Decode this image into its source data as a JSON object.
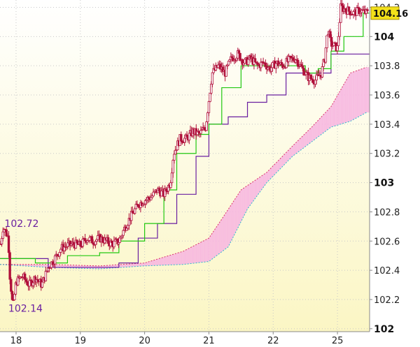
{
  "chart_data": {
    "type": "candlestick",
    "y_ticks": [
      {
        "value": 102,
        "label": "102",
        "major": true
      },
      {
        "value": 102.2,
        "label": "102.2",
        "major": false
      },
      {
        "value": 102.4,
        "label": "102.4",
        "major": false
      },
      {
        "value": 102.6,
        "label": "102.6",
        "major": false
      },
      {
        "value": 102.8,
        "label": "102.8",
        "major": false
      },
      {
        "value": 103,
        "label": "103",
        "major": true
      },
      {
        "value": 103.2,
        "label": "103.2",
        "major": false
      },
      {
        "value": 103.4,
        "label": "103.4",
        "major": false
      },
      {
        "value": 103.6,
        "label": "103.6",
        "major": false
      },
      {
        "value": 103.8,
        "label": "103.8",
        "major": false
      },
      {
        "value": 104,
        "label": "104",
        "major": true
      },
      {
        "value": 104.2,
        "label": "104.2",
        "major": false
      }
    ],
    "x_ticks": [
      {
        "value": 0,
        "label": "18"
      },
      {
        "value": 1,
        "label": "19"
      },
      {
        "value": 2,
        "label": "20"
      },
      {
        "value": 3,
        "label": "21"
      },
      {
        "value": 4,
        "label": "22"
      },
      {
        "value": 5,
        "label": "25"
      }
    ],
    "xlim": [
      -0.25,
      5.5
    ],
    "ylim": [
      101.98,
      104.25
    ],
    "current_price": {
      "value": 104.16,
      "label": "104.16"
    },
    "annotations": [
      {
        "label": "102.72",
        "x": -0.18,
        "y": 102.72
      },
      {
        "label": "102.14",
        "x": -0.12,
        "y": 102.14
      }
    ],
    "ohlc_path": [
      [
        -0.25,
        102.55
      ],
      [
        -0.2,
        102.7
      ],
      [
        -0.12,
        102.62
      ],
      [
        -0.1,
        102.38
      ],
      [
        -0.05,
        102.14
      ],
      [
        0.0,
        102.32
      ],
      [
        0.1,
        102.36
      ],
      [
        0.2,
        102.3
      ],
      [
        0.3,
        102.35
      ],
      [
        0.4,
        102.3
      ],
      [
        0.5,
        102.42
      ],
      [
        0.6,
        102.48
      ],
      [
        0.7,
        102.55
      ],
      [
        0.8,
        102.57
      ],
      [
        0.9,
        102.58
      ],
      [
        1.0,
        102.57
      ],
      [
        1.1,
        102.62
      ],
      [
        1.2,
        102.6
      ],
      [
        1.3,
        102.62
      ],
      [
        1.4,
        102.6
      ],
      [
        1.5,
        102.58
      ],
      [
        1.6,
        102.6
      ],
      [
        1.7,
        102.7
      ],
      [
        1.8,
        102.78
      ],
      [
        1.9,
        102.85
      ],
      [
        2.0,
        102.88
      ],
      [
        2.1,
        102.9
      ],
      [
        2.2,
        102.95
      ],
      [
        2.3,
        102.92
      ],
      [
        2.4,
        103.0
      ],
      [
        2.45,
        103.2
      ],
      [
        2.55,
        103.3
      ],
      [
        2.65,
        103.3
      ],
      [
        2.75,
        103.35
      ],
      [
        2.85,
        103.33
      ],
      [
        2.95,
        103.38
      ],
      [
        3.05,
        103.75
      ],
      [
        3.15,
        103.8
      ],
      [
        3.25,
        103.75
      ],
      [
        3.35,
        103.85
      ],
      [
        3.45,
        103.88
      ],
      [
        3.55,
        103.82
      ],
      [
        3.65,
        103.85
      ],
      [
        3.75,
        103.8
      ],
      [
        3.85,
        103.82
      ],
      [
        3.95,
        103.78
      ],
      [
        4.05,
        103.82
      ],
      [
        4.15,
        103.8
      ],
      [
        4.25,
        103.84
      ],
      [
        4.35,
        103.85
      ],
      [
        4.45,
        103.78
      ],
      [
        4.55,
        103.72
      ],
      [
        4.65,
        103.7
      ],
      [
        4.75,
        103.75
      ],
      [
        4.8,
        103.85
      ],
      [
        4.85,
        104.05
      ],
      [
        4.9,
        103.95
      ],
      [
        5.0,
        103.92
      ],
      [
        5.05,
        104.2
      ],
      [
        5.15,
        104.18
      ],
      [
        5.25,
        104.16
      ],
      [
        5.35,
        104.18
      ],
      [
        5.45,
        104.16
      ]
    ],
    "conversion_line": [
      [
        -0.25,
        102.48
      ],
      [
        0.3,
        102.45
      ],
      [
        0.8,
        102.5
      ],
      [
        1.3,
        102.52
      ],
      [
        1.6,
        102.6
      ],
      [
        2.0,
        102.72
      ],
      [
        2.3,
        102.95
      ],
      [
        2.5,
        103.2
      ],
      [
        2.8,
        103.33
      ],
      [
        3.0,
        103.4
      ],
      [
        3.2,
        103.65
      ],
      [
        3.5,
        103.8
      ],
      [
        4.0,
        103.8
      ],
      [
        4.5,
        103.75
      ],
      [
        4.7,
        103.78
      ],
      [
        4.9,
        103.9
      ],
      [
        5.1,
        104.0
      ],
      [
        5.4,
        104.16
      ]
    ],
    "base_line": [
      [
        -0.25,
        102.48
      ],
      [
        0.5,
        102.42
      ],
      [
        1.0,
        102.42
      ],
      [
        1.6,
        102.45
      ],
      [
        1.9,
        102.62
      ],
      [
        2.2,
        102.72
      ],
      [
        2.5,
        102.92
      ],
      [
        2.8,
        103.18
      ],
      [
        3.0,
        103.4
      ],
      [
        3.3,
        103.45
      ],
      [
        3.6,
        103.55
      ],
      [
        3.9,
        103.6
      ],
      [
        4.2,
        103.75
      ],
      [
        4.6,
        103.75
      ],
      [
        4.9,
        103.88
      ],
      [
        5.45,
        103.88
      ]
    ],
    "senkou_span_a": [
      [
        -0.25,
        102.44
      ],
      [
        0.5,
        102.44
      ],
      [
        1.3,
        102.43
      ],
      [
        2.0,
        102.45
      ],
      [
        2.6,
        102.53
      ],
      [
        3.0,
        102.62
      ],
      [
        3.2,
        102.75
      ],
      [
        3.5,
        102.95
      ],
      [
        3.9,
        103.07
      ],
      [
        4.3,
        103.25
      ],
      [
        4.6,
        103.38
      ],
      [
        4.9,
        103.52
      ],
      [
        5.2,
        103.75
      ],
      [
        5.45,
        103.79
      ]
    ],
    "senkou_span_b": [
      [
        -0.25,
        102.44
      ],
      [
        0.5,
        102.42
      ],
      [
        1.3,
        102.41
      ],
      [
        2.0,
        102.43
      ],
      [
        2.6,
        102.44
      ],
      [
        3.0,
        102.46
      ],
      [
        3.3,
        102.56
      ],
      [
        3.6,
        102.82
      ],
      [
        3.9,
        103.0
      ],
      [
        4.3,
        103.18
      ],
      [
        4.6,
        103.28
      ],
      [
        4.9,
        103.38
      ],
      [
        5.2,
        103.42
      ],
      [
        5.45,
        103.48
      ]
    ],
    "colors": {
      "background_top": "#ffffff",
      "background_bottom": "#fbf6c4",
      "grid": "#c8c8c8",
      "candles": "#b0103a",
      "conversion_line": "#22c811",
      "base_line": "#6a1fa0",
      "cloud_bull": "#f7b6e0",
      "cloud_bear": "#b6f0b0",
      "span_a": "#d8356a",
      "span_b": "#2cb8d0",
      "price_tag": "#f3e11a"
    }
  }
}
